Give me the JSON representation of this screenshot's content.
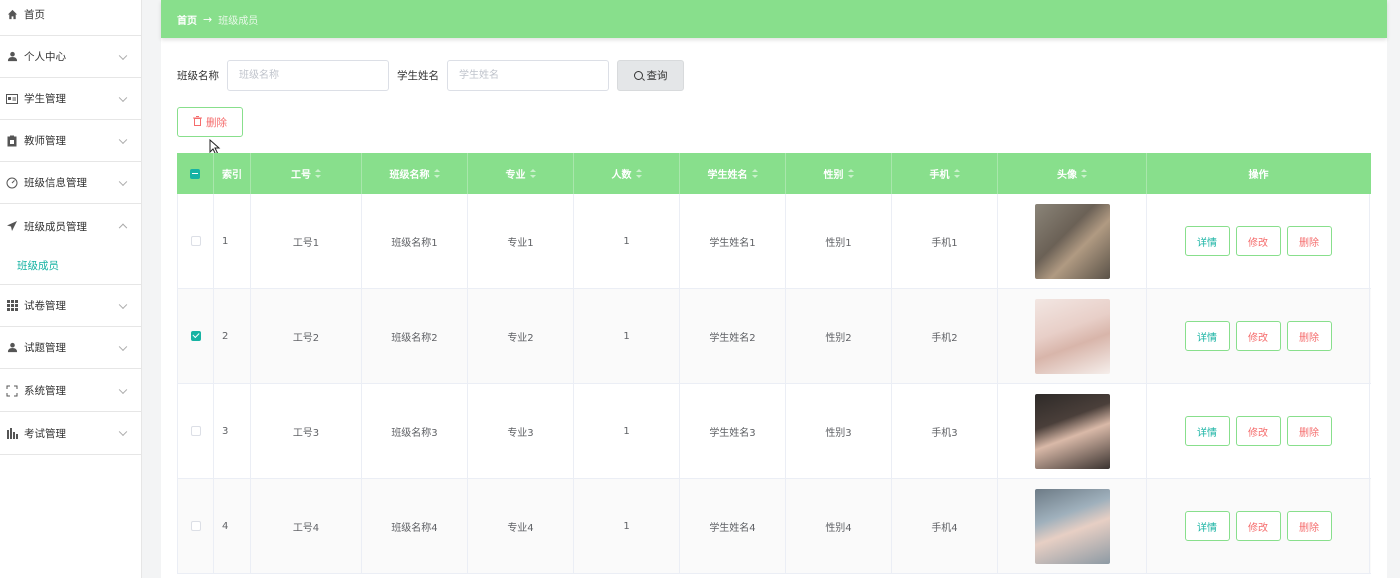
{
  "sidebar": {
    "items": [
      {
        "label": "首页",
        "icon": "home-icon",
        "chevron": false
      },
      {
        "label": "个人中心",
        "icon": "user-icon",
        "chevron": true
      },
      {
        "label": "学生管理",
        "icon": "id-card-icon",
        "chevron": true
      },
      {
        "label": "教师管理",
        "icon": "clipboard-icon",
        "chevron": true
      },
      {
        "label": "班级信息管理",
        "icon": "gauge-icon",
        "chevron": true
      },
      {
        "label": "班级成员管理",
        "icon": "send-icon",
        "chevron": true,
        "expanded": true
      },
      {
        "label": "试卷管理",
        "icon": "grid-icon",
        "chevron": true
      },
      {
        "label": "试题管理",
        "icon": "user-icon",
        "chevron": true
      },
      {
        "label": "系统管理",
        "icon": "frame-icon",
        "chevron": true
      },
      {
        "label": "考试管理",
        "icon": "bar-chart-icon",
        "chevron": true
      }
    ],
    "submenu_active": "班级成员"
  },
  "breadcrumb": {
    "home": "首页",
    "arrow": "→",
    "current": "班级成员"
  },
  "search": {
    "class_label": "班级名称",
    "class_placeholder": "班级名称",
    "student_label": "学生姓名",
    "student_placeholder": "学生姓名",
    "query_label": "查询"
  },
  "toolbar": {
    "delete_label": "删除"
  },
  "table": {
    "headers": [
      "索引",
      "工号",
      "班级名称",
      "专业",
      "人数",
      "学生姓名",
      "性别",
      "手机",
      "头像",
      "操作"
    ],
    "rows": [
      {
        "checked": false,
        "index": "1",
        "job_no": "工号1",
        "class_name": "班级名称1",
        "major": "专业1",
        "count": "1",
        "student": "学生姓名1",
        "gender": "性别1",
        "phone": "手机1"
      },
      {
        "checked": true,
        "index": "2",
        "job_no": "工号2",
        "class_name": "班级名称2",
        "major": "专业2",
        "count": "1",
        "student": "学生姓名2",
        "gender": "性别2",
        "phone": "手机2"
      },
      {
        "checked": false,
        "index": "3",
        "job_no": "工号3",
        "class_name": "班级名称3",
        "major": "专业3",
        "count": "1",
        "student": "学生姓名3",
        "gender": "性别3",
        "phone": "手机3"
      },
      {
        "checked": false,
        "index": "4",
        "job_no": "工号4",
        "class_name": "班级名称4",
        "major": "专业4",
        "count": "1",
        "student": "学生姓名4",
        "gender": "性别4",
        "phone": "手机4"
      }
    ],
    "actions": {
      "detail": "详情",
      "edit": "修改",
      "delete": "删除"
    }
  },
  "colors": {
    "accent_green": "#88df8c",
    "teal": "#17b3a3",
    "danger": "#f56c6c"
  }
}
